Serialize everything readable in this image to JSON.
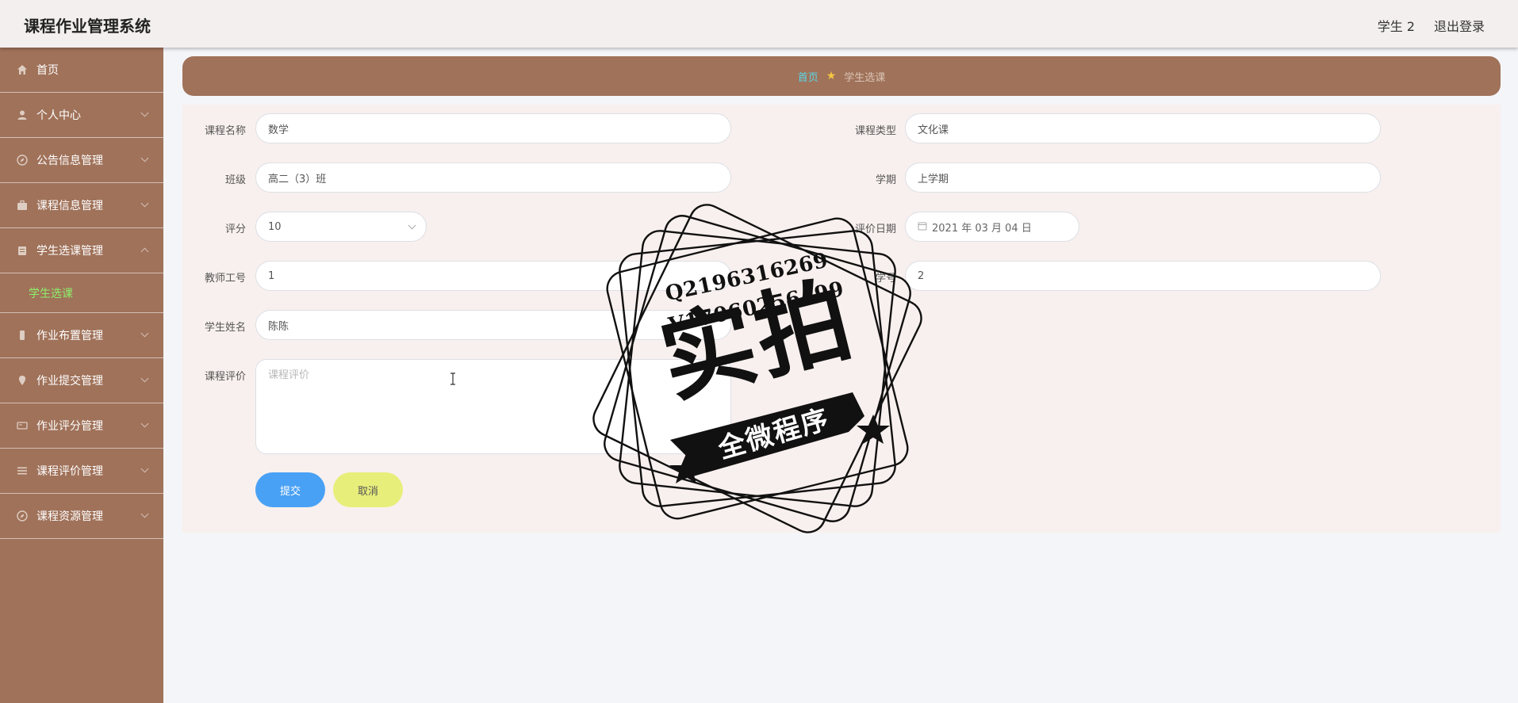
{
  "header": {
    "title": "课程作业管理系统",
    "user": "学生 2",
    "logout": "退出登录"
  },
  "sidebar": {
    "items": [
      {
        "label": "首页",
        "icon": "home-icon"
      },
      {
        "label": "个人中心",
        "icon": "user-icon"
      },
      {
        "label": "公告信息管理",
        "icon": "compass-icon"
      },
      {
        "label": "课程信息管理",
        "icon": "briefcase-icon"
      },
      {
        "label": "学生选课管理",
        "icon": "clipboard-icon"
      },
      {
        "label": "作业布置管理",
        "icon": "phone-icon"
      },
      {
        "label": "作业提交管理",
        "icon": "location-icon"
      },
      {
        "label": "作业评分管理",
        "icon": "id-card-icon"
      },
      {
        "label": "课程评价管理",
        "icon": "list-icon"
      },
      {
        "label": "课程资源管理",
        "icon": "compass-icon"
      }
    ],
    "sub_item": "学生选课"
  },
  "breadcrumb": {
    "home": "首页",
    "current": "学生选课"
  },
  "form": {
    "course_name": {
      "label": "课程名称",
      "value": "数学"
    },
    "course_type": {
      "label": "课程类型",
      "value": "文化课"
    },
    "class": {
      "label": "班级",
      "value": "高二（3）班"
    },
    "semester": {
      "label": "学期",
      "value": "上学期"
    },
    "score": {
      "label": "评分",
      "value": "10"
    },
    "eval_date": {
      "label": "评价日期",
      "value": "2021 年 03 月 04 日"
    },
    "teacher_id": {
      "label": "教师工号",
      "value": "1"
    },
    "student_id": {
      "label": "学号",
      "value": "2"
    },
    "student_name": {
      "label": "学生姓名",
      "value": "陈陈"
    },
    "evaluation": {
      "label": "课程评价",
      "placeholder": "课程评价"
    },
    "submit": "提交",
    "cancel": "取消"
  },
  "watermark": {
    "line1": "Q2196316269",
    "line2": "V17060256499",
    "big": "实拍",
    "ribbon": "全微程序"
  }
}
